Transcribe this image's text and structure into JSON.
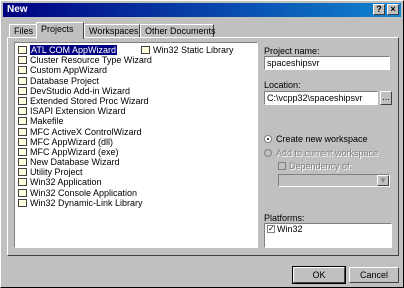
{
  "window": {
    "title": "New",
    "help_glyph": "?",
    "close_glyph": "×"
  },
  "tabs": [
    "Files",
    "Projects",
    "Workspaces",
    "Other Documents"
  ],
  "project_types_col1": [
    "ATL COM AppWizard",
    "Cluster Resource Type Wizard",
    "Custom AppWizard",
    "Database Project",
    "DevStudio Add-in Wizard",
    "Extended Stored Proc Wizard",
    "ISAPI Extension Wizard",
    "Makefile",
    "MFC ActiveX ControlWizard",
    "MFC AppWizard (dll)",
    "MFC AppWizard (exe)",
    "New Database Wizard",
    "Utility Project",
    "Win32 Application",
    "Win32 Console Application",
    "Win32 Dynamic-Link Library"
  ],
  "project_types_col2": [
    "Win32 Static Library"
  ],
  "selected_type": "ATL COM AppWizard",
  "project_name": {
    "label": "Project name:",
    "value": "spaceshipsvr"
  },
  "location": {
    "label": "Location:",
    "value": "C:\\vcpp32\\spaceshipsvr",
    "browse_label": "..."
  },
  "options": {
    "create_new": "Create new workspace",
    "add_to_current": "Add to current workspace",
    "dependency": "Dependency of:"
  },
  "platforms": {
    "label": "Platforms:",
    "items": [
      "Win32"
    ]
  },
  "buttons": {
    "ok": "OK",
    "cancel": "Cancel"
  }
}
